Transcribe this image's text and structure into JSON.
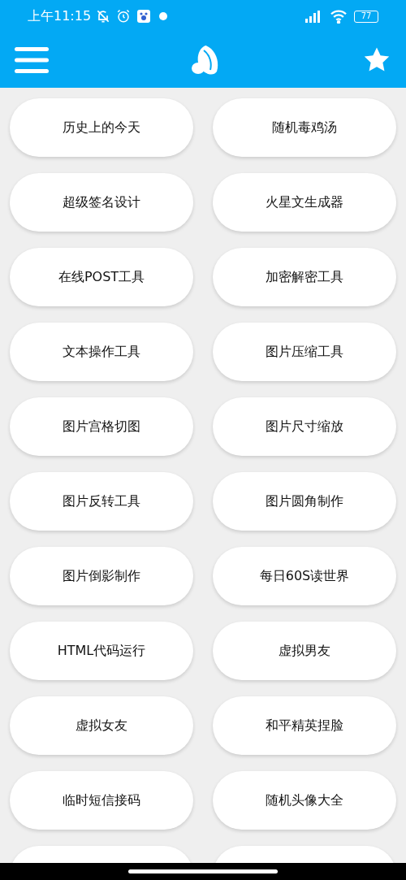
{
  "status_bar": {
    "time": "上午11:15",
    "battery": "77"
  },
  "tools": [
    {
      "label": "历史上的今天"
    },
    {
      "label": "随机毒鸡汤"
    },
    {
      "label": "超级签名设计"
    },
    {
      "label": "火星文生成器"
    },
    {
      "label": "在线POST工具"
    },
    {
      "label": "加密解密工具"
    },
    {
      "label": "文本操作工具"
    },
    {
      "label": "图片压缩工具"
    },
    {
      "label": "图片宫格切图"
    },
    {
      "label": "图片尺寸缩放"
    },
    {
      "label": "图片反转工具"
    },
    {
      "label": "图片圆角制作"
    },
    {
      "label": "图片倒影制作"
    },
    {
      "label": "每日60S读世界"
    },
    {
      "label": "HTML代码运行"
    },
    {
      "label": "虚拟男友"
    },
    {
      "label": "虚拟女友"
    },
    {
      "label": "和平精英捏脸"
    },
    {
      "label": "临时短信接码"
    },
    {
      "label": "随机头像大全"
    }
  ]
}
